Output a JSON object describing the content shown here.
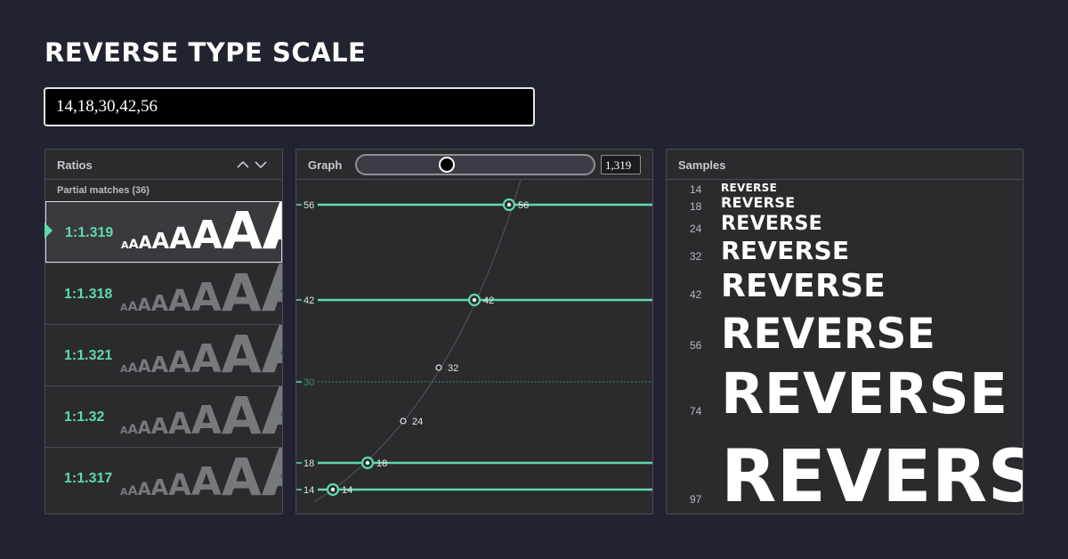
{
  "app": {
    "title": "REVERSE TYPE SCALE"
  },
  "input": {
    "value": "14,18,30,42,56"
  },
  "ratios_panel": {
    "title": "Ratios",
    "partial_matches": "Partial matches (36)",
    "sample_glyphs": "AAAAAAAA",
    "items": [
      {
        "label": "1:1.319",
        "selected": true
      },
      {
        "label": "1:1.318",
        "selected": false
      },
      {
        "label": "1:1.321",
        "selected": false
      },
      {
        "label": "1:1.32",
        "selected": false
      },
      {
        "label": "1:1.317",
        "selected": false
      }
    ]
  },
  "graph_panel": {
    "title": "Graph",
    "ratio_value": "1,319",
    "slider_position": 0.37,
    "axis_labels": [
      "56",
      "42",
      "30",
      "18",
      "14"
    ],
    "matched_sizes": [
      56,
      42,
      18,
      14
    ],
    "unmatched_target": 30,
    "point_labels": [
      "56",
      "42",
      "32",
      "24",
      "18",
      "14"
    ],
    "accent_color": "#5fd9ad"
  },
  "samples_panel": {
    "title": "Samples",
    "word": "REVERSE",
    "sizes": [
      "14",
      "18",
      "24",
      "32",
      "42",
      "56",
      "74",
      "97"
    ]
  }
}
